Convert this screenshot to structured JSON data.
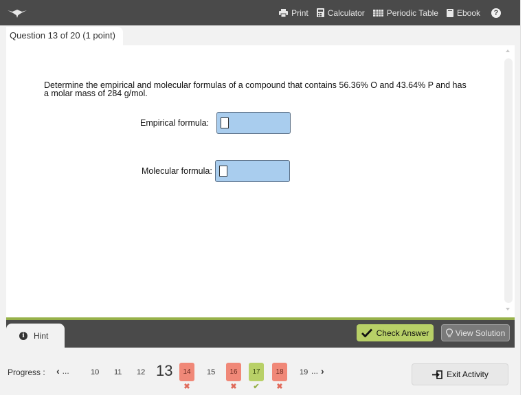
{
  "toolbar": {
    "print_label": "Print",
    "calculator_label": "Calculator",
    "periodic_table_label": "Periodic Table",
    "ebook_label": "Ebook",
    "help_symbol": "?"
  },
  "question_tab": {
    "label": "Question 13 of 20 (1 point)"
  },
  "question": {
    "text": "Determine the empirical and molecular formulas of a compound that contains 56.36% O and 43.64% P and has a molar mass of 284 g/mol.",
    "empirical_label": "Empirical formula:",
    "empirical_value": "",
    "molecular_label": "Molecular formula:",
    "molecular_value": ""
  },
  "actions": {
    "hint_label": "Hint",
    "check_answer_label": "Check Answer",
    "view_solution_label": "View Solution",
    "exit_label": "Exit Activity"
  },
  "progress": {
    "label": "Progress :",
    "prev_label": "...",
    "next_label": "...",
    "current": "13",
    "items": [
      {
        "num": "10",
        "status": "none"
      },
      {
        "num": "11",
        "status": "none"
      },
      {
        "num": "12",
        "status": "none"
      },
      {
        "num": "14",
        "status": "wrong"
      },
      {
        "num": "15",
        "status": "none"
      },
      {
        "num": "16",
        "status": "wrong"
      },
      {
        "num": "17",
        "status": "correct"
      },
      {
        "num": "18",
        "status": "wrong"
      },
      {
        "num": "19",
        "status": "none"
      }
    ],
    "wrong_mark": "✖",
    "correct_mark": "✔"
  },
  "colors": {
    "topbar": "#4a4a4a",
    "input_fill": "#a9cdee",
    "accent_green": "#b8d067",
    "wrong_red": "#f08878"
  }
}
